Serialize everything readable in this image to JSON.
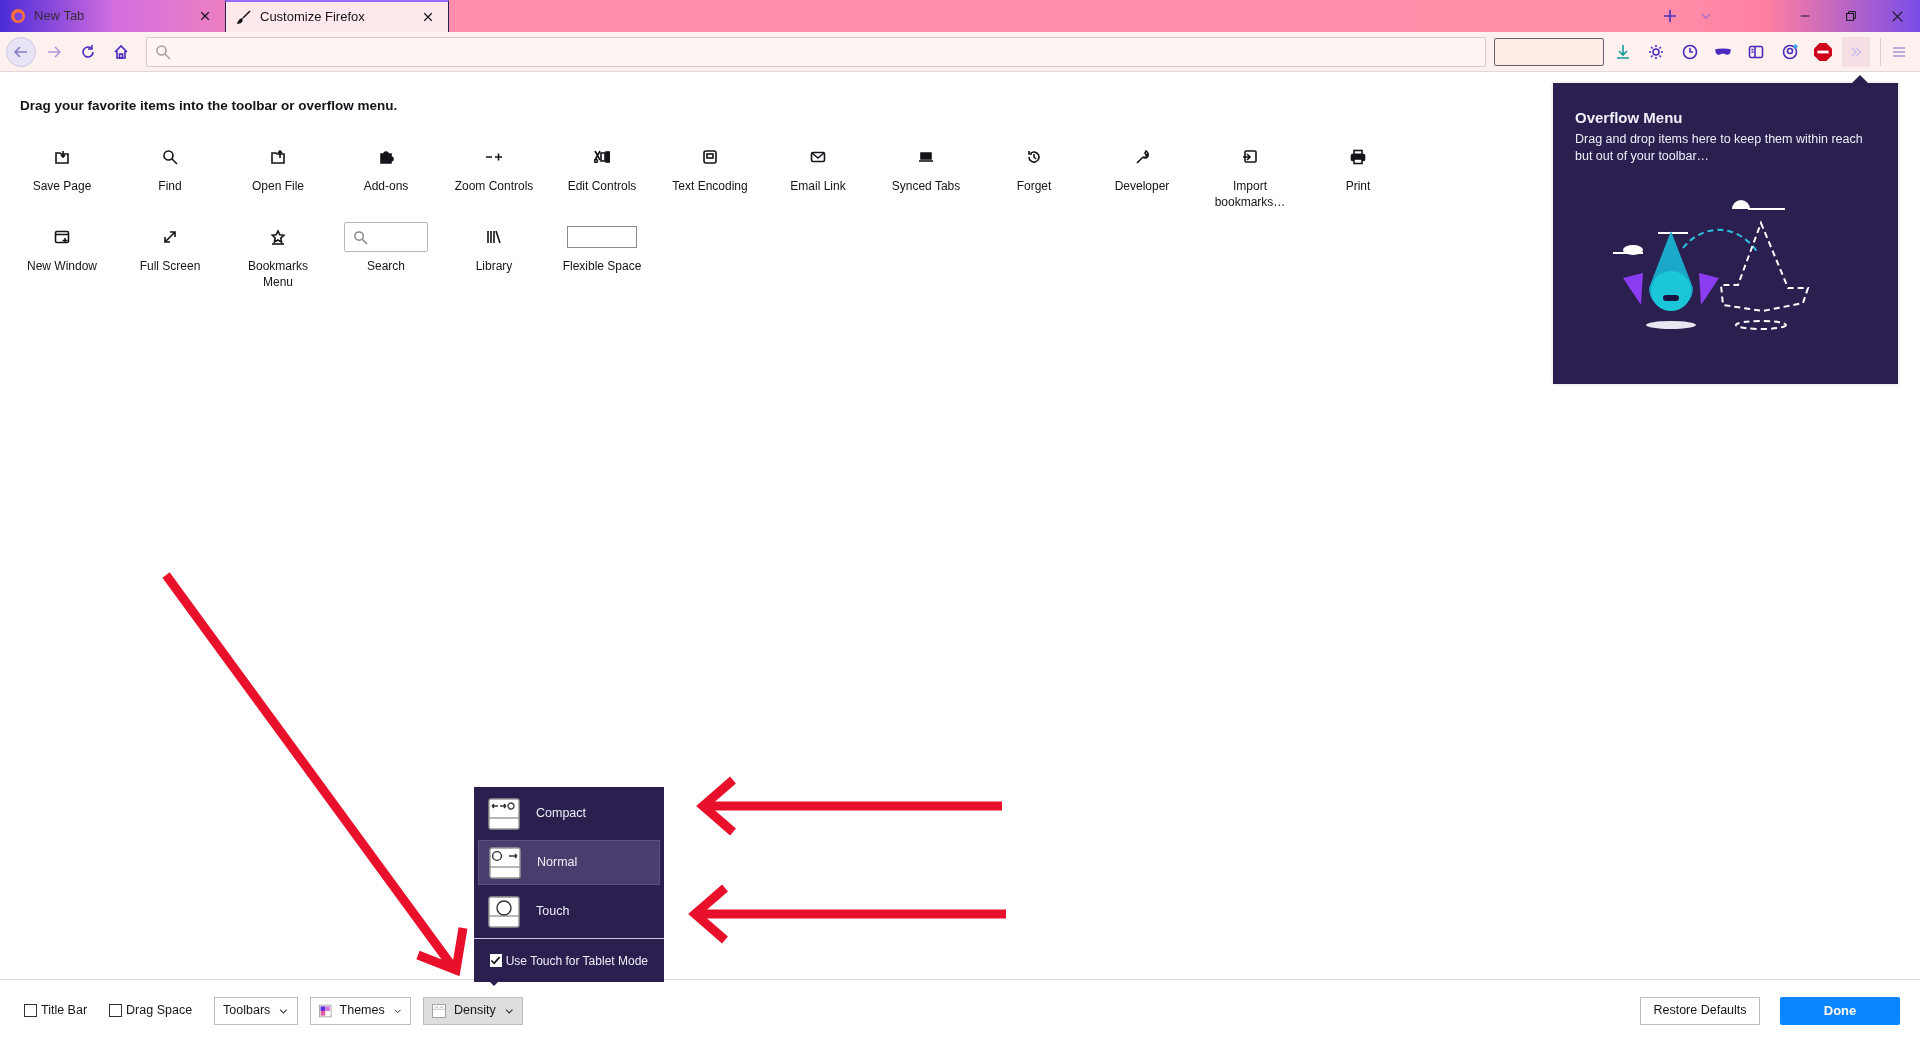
{
  "tabs": [
    {
      "label": "New Tab",
      "selected": false
    },
    {
      "label": "Customize Firefox",
      "selected": true
    }
  ],
  "heading": "Drag your favorite items into the toolbar or overflow menu.",
  "palette": [
    {
      "kind": "icon",
      "label": "Save Page"
    },
    {
      "kind": "icon",
      "label": "Find"
    },
    {
      "kind": "icon",
      "label": "Open File"
    },
    {
      "kind": "icon",
      "label": "Add-ons"
    },
    {
      "kind": "icon",
      "label": "Zoom Controls"
    },
    {
      "kind": "icon",
      "label": "Edit Controls"
    },
    {
      "kind": "icon",
      "label": "Text Encoding"
    },
    {
      "kind": "icon",
      "label": "Email Link"
    },
    {
      "kind": "icon",
      "label": "Synced Tabs"
    },
    {
      "kind": "icon",
      "label": "Forget"
    },
    {
      "kind": "icon",
      "label": "Developer"
    },
    {
      "kind": "icon",
      "label": "Import bookmarks…"
    },
    {
      "kind": "icon",
      "label": "Print"
    },
    {
      "kind": "icon",
      "label": "New Window"
    },
    {
      "kind": "icon",
      "label": "Full Screen"
    },
    {
      "kind": "icon",
      "label": "Bookmarks Menu"
    },
    {
      "kind": "search",
      "label": "Search"
    },
    {
      "kind": "icon",
      "label": "Library"
    },
    {
      "kind": "space",
      "label": "Flexible Space"
    }
  ],
  "overflow_panel": {
    "title": "Overflow Menu",
    "text": "Drag and drop items here to keep them within reach but out of your toolbar…"
  },
  "density_menu": {
    "options": [
      {
        "label": "Compact",
        "selected": false
      },
      {
        "label": "Normal",
        "selected": true
      },
      {
        "label": "Touch",
        "selected": false
      }
    ],
    "tablet_checkbox": {
      "label": "Use Touch for Tablet Mode",
      "checked": true
    }
  },
  "footer": {
    "checkboxes": [
      {
        "label": "Title Bar",
        "checked": false
      },
      {
        "label": "Drag Space",
        "checked": false
      }
    ],
    "dropdowns": [
      {
        "label": "Toolbars",
        "expanded": false
      },
      {
        "label": "Themes",
        "expanded": false
      },
      {
        "label": "Density",
        "expanded": true
      }
    ],
    "restore_button": "Restore Defaults",
    "done_button": "Done"
  }
}
